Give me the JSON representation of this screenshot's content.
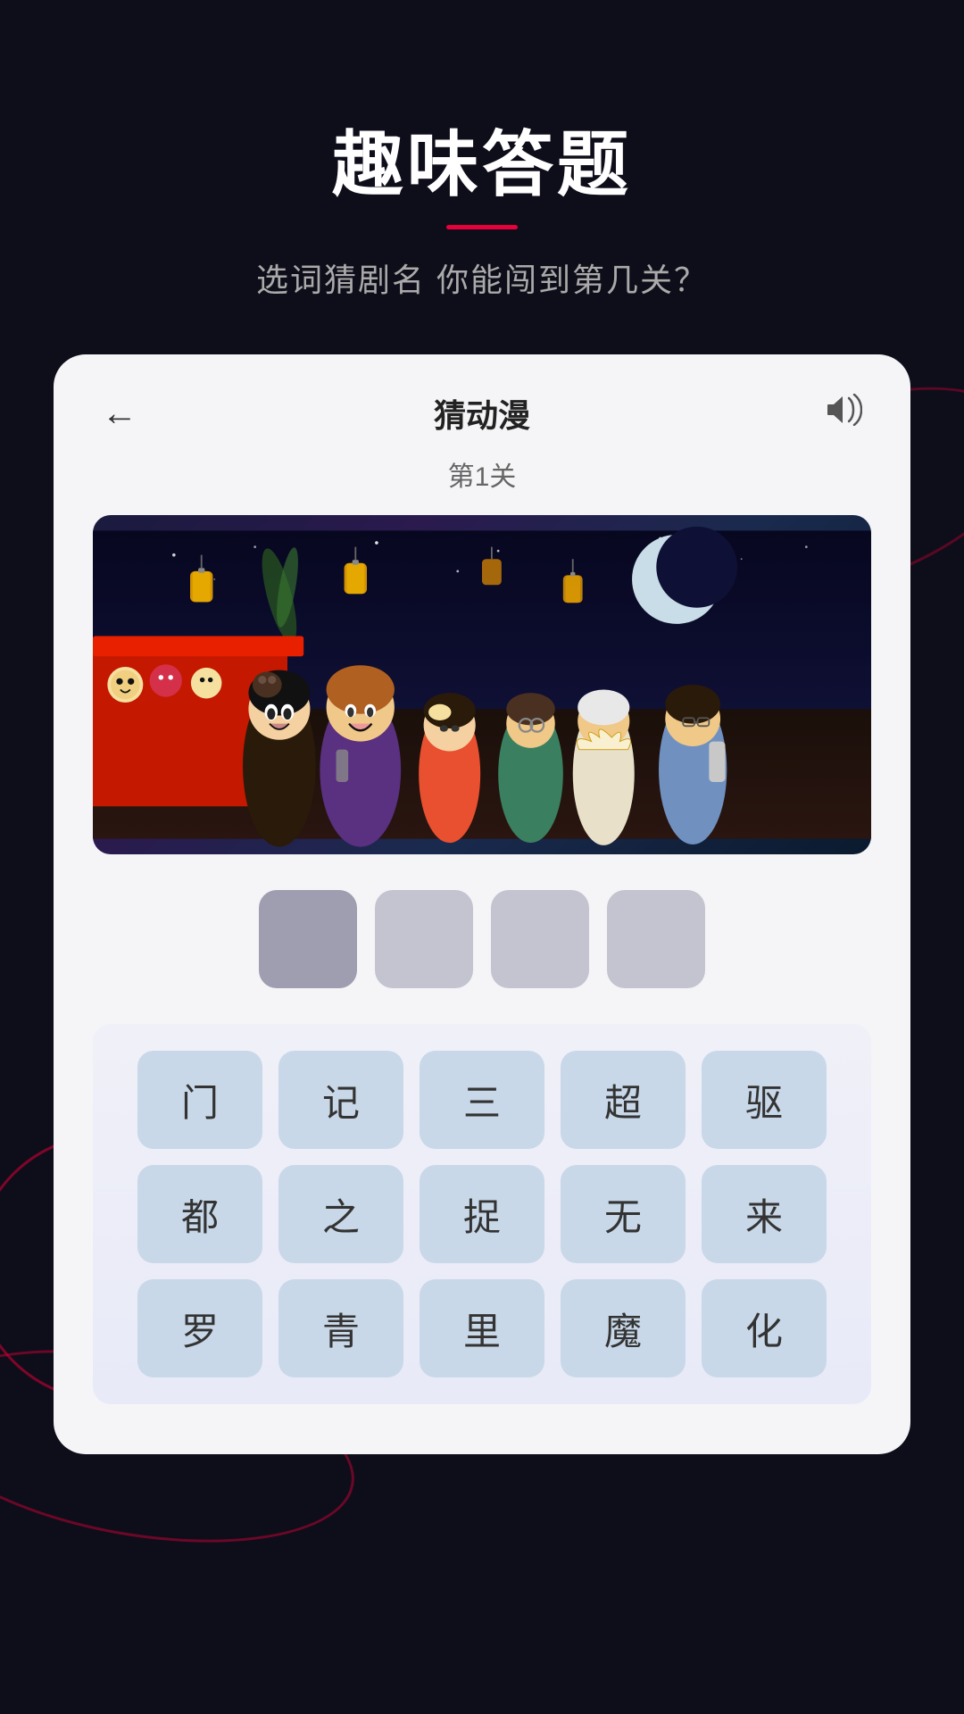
{
  "page": {
    "title": "趣味答题",
    "subtitle": "选词猜剧名 你能闯到第几关？",
    "title_underline_color": "#e8003a"
  },
  "game": {
    "card_title": "猜动漫",
    "level_label": "第1关",
    "back_button": "←",
    "sound_icon": "🔊",
    "answer_boxes_count": 4,
    "answer_boxes": [
      {
        "filled": true
      },
      {
        "filled": false
      },
      {
        "filled": false
      },
      {
        "filled": false
      }
    ],
    "keyboard_rows": [
      [
        "门",
        "记",
        "三",
        "超",
        "驱"
      ],
      [
        "都",
        "之",
        "捉",
        "无",
        "来"
      ],
      [
        "罗",
        "青",
        "里",
        "魔",
        "化"
      ]
    ]
  },
  "colors": {
    "background": "#0e0e1a",
    "card_bg": "#f5f5f8",
    "accent": "#e8003a",
    "answer_box_empty": "#c8cad4",
    "answer_box_filled": "#9a9cac",
    "char_btn_bg": "#c8d8e8",
    "keyboard_area_bg_start": "#f0f0f8",
    "keyboard_area_bg_end": "#e0e4f8"
  }
}
